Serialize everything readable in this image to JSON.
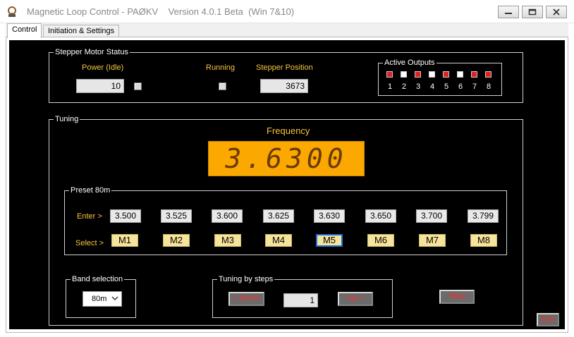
{
  "window": {
    "title": "Magnetic Loop Control - PAØKV    Version 4.0.1 Beta  (Win 7&10)",
    "icon": "loop-antenna-icon"
  },
  "tabs": [
    {
      "label": "Control",
      "active": true
    },
    {
      "label": "Initiation & Settings",
      "active": false
    }
  ],
  "stepper_status": {
    "group_title": "Stepper Motor Status",
    "power_label": "Power (Idle)",
    "power_value": "10",
    "running_label": "Running",
    "position_label": "Stepper Position",
    "position_value": "3673"
  },
  "active_outputs": {
    "title": "Active Outputs",
    "outputs": [
      {
        "num": "1",
        "on": true
      },
      {
        "num": "2",
        "on": false
      },
      {
        "num": "3",
        "on": true
      },
      {
        "num": "4",
        "on": false
      },
      {
        "num": "5",
        "on": true
      },
      {
        "num": "6",
        "on": false
      },
      {
        "num": "7",
        "on": true
      },
      {
        "num": "8",
        "on": true
      }
    ],
    "on_color": "#e81d1d",
    "off_color": "#ffffff"
  },
  "tuning": {
    "group_title": "Tuning",
    "frequency_label": "Frequency",
    "frequency_value": "3.6300",
    "display_color": "#fba900"
  },
  "preset": {
    "title": "Preset 80m",
    "enter_label": "Enter >",
    "select_label": "Select >",
    "values": [
      "3.500",
      "3.525",
      "3.600",
      "3.625",
      "3.630",
      "3.650",
      "3.700",
      "3.799"
    ],
    "memories": [
      "M1",
      "M2",
      "M3",
      "M4",
      "M5",
      "M6",
      "M7",
      "M8"
    ],
    "selected_memory": "M5"
  },
  "band": {
    "title": "Band selection",
    "selected": "80m"
  },
  "steps": {
    "title": "Tuning by steps",
    "down_label": "< Down",
    "value": "1",
    "up_label": "Up  >"
  },
  "buttons": {
    "stop_label": "Stop",
    "exit_label": "Exit"
  },
  "colors": {
    "label_yellow": "#f6c440",
    "background": "#000000",
    "memory_button": "#f7e49c",
    "action_text": "#ff2a2a"
  }
}
